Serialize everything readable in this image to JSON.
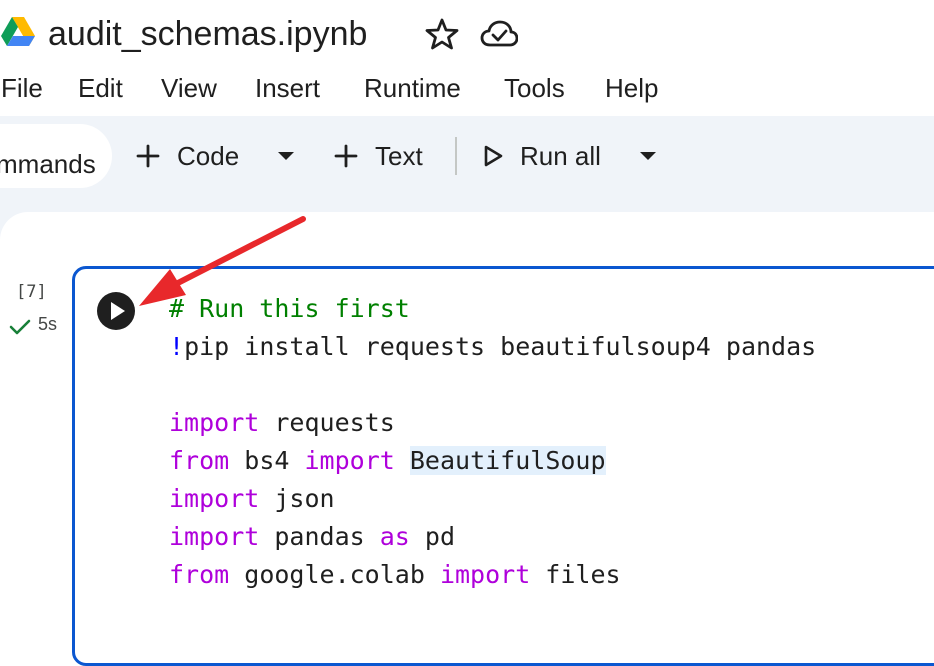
{
  "title": "audit_schemas.ipynb",
  "icons": {
    "logo": "google-drive-logo",
    "star": "star-outline-icon",
    "cloud": "cloud-saved-icon"
  },
  "menu": [
    "File",
    "Edit",
    "View",
    "Insert",
    "Runtime",
    "Tools",
    "Help"
  ],
  "toolbar": {
    "commands_label": "mmands",
    "code_label": "Code",
    "text_label": "Text",
    "run_all_label": "Run all"
  },
  "cell": {
    "execution_count": "[7]",
    "duration": "5s",
    "status": "success",
    "code_lines": [
      [
        {
          "t": "# Run this first",
          "c": "comment"
        }
      ],
      [
        {
          "t": "!",
          "c": "bang"
        },
        {
          "t": "pip install requests beautifulsoup4 pandas",
          "c": "plain"
        }
      ],
      [],
      [
        {
          "t": "import",
          "c": "kw"
        },
        {
          "t": " requests",
          "c": "plain"
        }
      ],
      [
        {
          "t": "from",
          "c": "kw"
        },
        {
          "t": " bs4 ",
          "c": "plain"
        },
        {
          "t": "import",
          "c": "kw"
        },
        {
          "t": " ",
          "c": "plain"
        },
        {
          "t": "BeautifulSoup",
          "c": "hl"
        }
      ],
      [
        {
          "t": "import",
          "c": "kw"
        },
        {
          "t": " json",
          "c": "plain"
        }
      ],
      [
        {
          "t": "import",
          "c": "kw"
        },
        {
          "t": " pandas ",
          "c": "plain"
        },
        {
          "t": "as",
          "c": "kw"
        },
        {
          "t": " pd",
          "c": "plain"
        }
      ],
      [
        {
          "t": "from",
          "c": "kw"
        },
        {
          "t": " google.colab ",
          "c": "plain"
        },
        {
          "t": "import",
          "c": "kw"
        },
        {
          "t": " files",
          "c": "plain"
        }
      ]
    ]
  },
  "colors": {
    "accent": "#0b57d0",
    "toolbar_bg": "#f0f4f9",
    "annotation_arrow": "#e8282b",
    "comment": "#008000",
    "keyword": "#af00db"
  }
}
